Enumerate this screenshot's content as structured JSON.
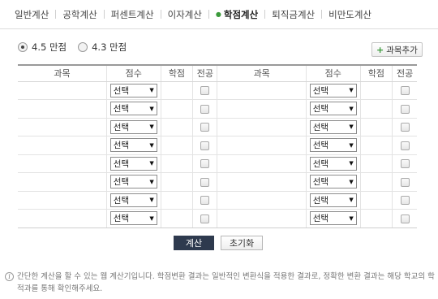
{
  "tabs": [
    {
      "label": "일반계산",
      "active": false
    },
    {
      "label": "공학계산",
      "active": false
    },
    {
      "label": "퍼센트계산",
      "active": false
    },
    {
      "label": "이자계산",
      "active": false
    },
    {
      "label": "학점계산",
      "active": true
    },
    {
      "label": "퇴직금계산",
      "active": false
    },
    {
      "label": "비만도계산",
      "active": false
    }
  ],
  "scale_options": [
    {
      "label": "4.5 만점",
      "checked": true
    },
    {
      "label": "4.3 만점",
      "checked": false
    }
  ],
  "add_subject_label": "과목추가",
  "table": {
    "headers": [
      "과목",
      "점수",
      "학점",
      "전공",
      "과목",
      "점수",
      "학점",
      "전공"
    ],
    "row_count": 8,
    "select_value": "선택"
  },
  "calc_label": "계산",
  "reset_label": "초기화",
  "note": "간단한 계산을 할 수 있는 웹 계산기입니다. 학점변환 결과는 일반적인 변환식을 적용한 결과로, 정확한 변환 결과는 해당 학교의 학적과를 통해 확인해주세요.",
  "colors": {
    "accent_green": "#3b9a3b",
    "calc_button": "#2e3a4e"
  }
}
